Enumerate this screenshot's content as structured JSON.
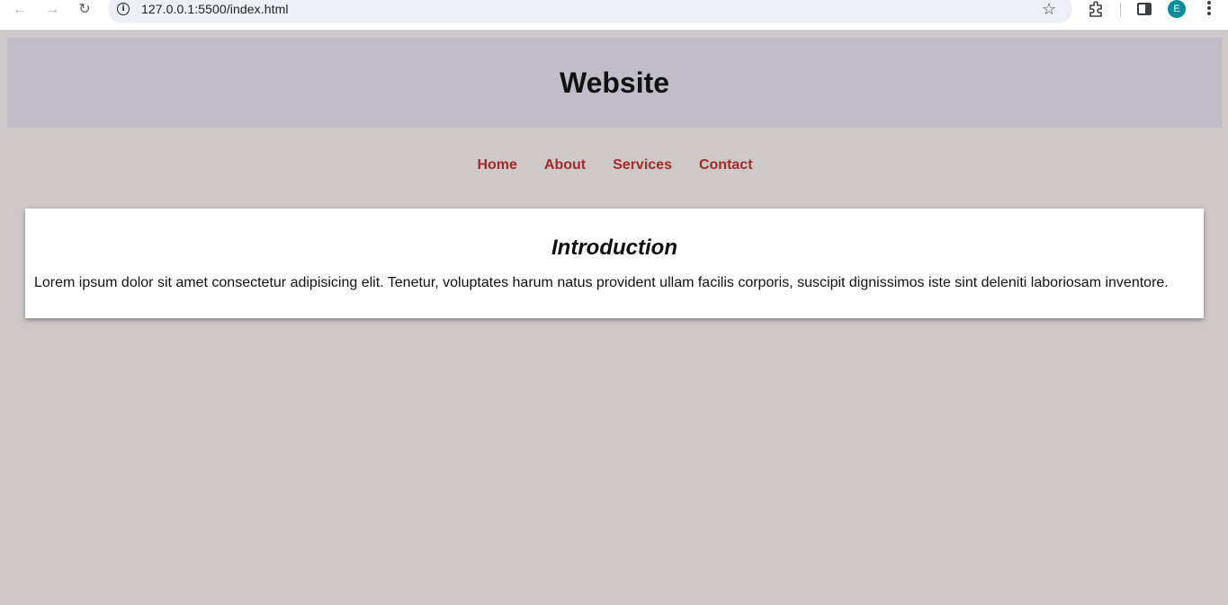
{
  "browser": {
    "url": "127.0.0.1:5500/index.html",
    "profile_initial": "E",
    "icons": [
      "back-arrow-icon",
      "forward-arrow-icon",
      "reload-icon",
      "site-info-icon",
      "bookmark-star-icon",
      "extensions-icon",
      "side-panel-icon",
      "menu-kebab-icon"
    ],
    "colors": {
      "avatar": "#0b8e9b"
    }
  },
  "site": {
    "title": "Website",
    "nav": [
      {
        "label": "Home"
      },
      {
        "label": "About"
      },
      {
        "label": "Services"
      },
      {
        "label": "Contact"
      }
    ],
    "section": {
      "heading": "Introduction",
      "body": "Lorem ipsum dolor sit amet consectetur adipisicing elit. Tenetur, voluptates harum natus provident ullam facilis corporis, suscipit dignissimos iste sint deleniti laboriosam inventore."
    },
    "colors": {
      "page_background": "#cfc8c9",
      "header_background": "#c0bcc8",
      "nav_link": "#a52a2a",
      "card_background": "#ffffff"
    }
  }
}
